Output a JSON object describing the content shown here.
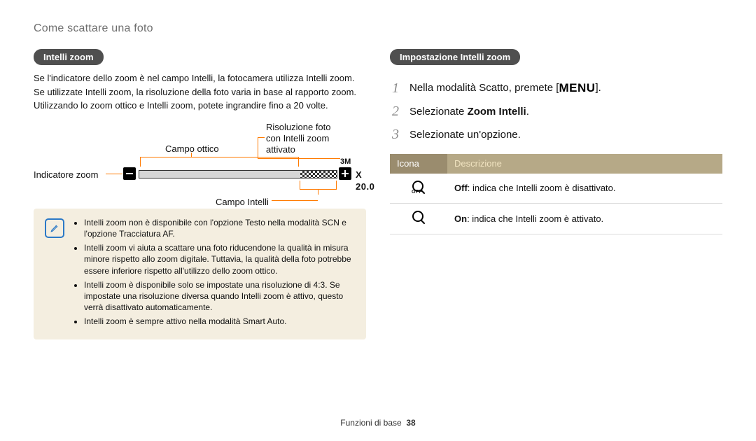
{
  "title": "Come scattare una foto",
  "left": {
    "heading": "Intelli zoom",
    "p1": "Se l'indicatore dello zoom è nel campo Intelli, la fotocamera utilizza Intelli zoom.",
    "p2": "Se utilizzate Intelli zoom, la risoluzione della foto varia in base al rapporto zoom.",
    "p3": "Utilizzando lo zoom ottico e Intelli zoom, potete ingrandire fino a 20 volte.",
    "diagram": {
      "indicator": "Indicatore zoom",
      "campo_ottico": "Campo ottico",
      "campo_intelli": "Campo Intelli",
      "res_label_l1": "Risoluzione foto",
      "res_label_l2": "con Intelli zoom",
      "res_label_l3": "attivato",
      "res_mark": "3M",
      "zoom_value": "X 20.0"
    },
    "notes": [
      "Intelli zoom non è disponibile con l'opzione Testo nella modalità SCN e l'opzione Tracciatura AF.",
      "Intelli zoom vi aiuta a scattare una foto riducendone la qualità in misura minore rispetto allo zoom digitale. Tuttavia, la qualità della foto potrebbe essere inferiore rispetto all'utilizzo dello zoom ottico.",
      "Intelli zoom è disponibile solo se impostate una risoluzione di 4:3. Se impostate una risoluzione diversa quando Intelli zoom è attivo, questo verrà disattivato automaticamente.",
      "Intelli zoom è sempre attivo nella modalità Smart Auto."
    ]
  },
  "right": {
    "heading": "Impostazione Intelli zoom",
    "steps": [
      {
        "n": "1",
        "pre": "Nella modalità Scatto, premete [",
        "menu": "MENU",
        "post": "]."
      },
      {
        "n": "2",
        "pre": "Selezionate ",
        "bold": "Zoom Intelli",
        "post": "."
      },
      {
        "n": "3",
        "text": "Selezionate un'opzione."
      }
    ],
    "table": {
      "h1": "Icona",
      "h2": "Descrizione",
      "rows": [
        {
          "off": true,
          "bold": "Off",
          "text": ": indica che Intelli zoom è disattivato."
        },
        {
          "off": false,
          "bold": "On",
          "text": ": indica che Intelli zoom è attivato."
        }
      ]
    }
  },
  "footer": {
    "section": "Funzioni di base",
    "page": "38"
  }
}
